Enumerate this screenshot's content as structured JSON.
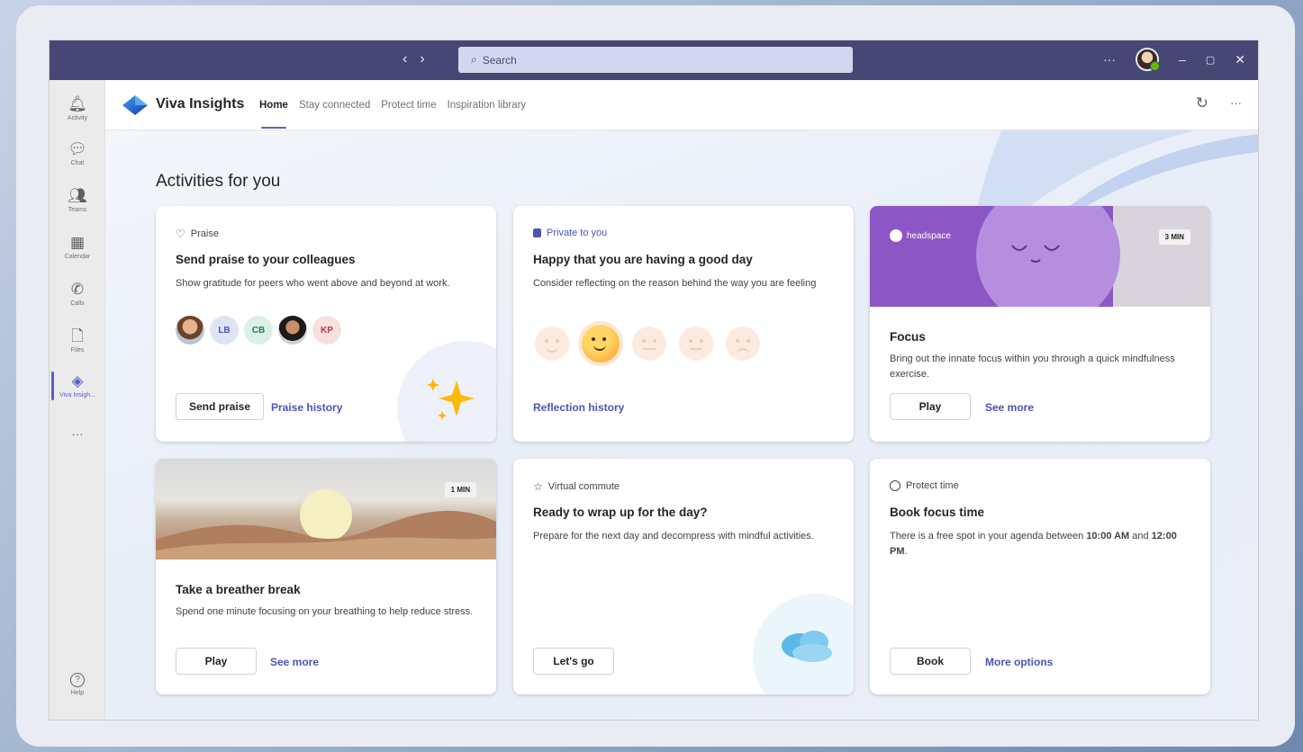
{
  "titlebar": {
    "back_icon": "chevron-left-icon",
    "forward_icon": "chevron-right-icon",
    "search_placeholder": "Search",
    "more_label": "···",
    "minimize_label": "–",
    "maximize_label": "▢",
    "close_label": "✕",
    "bg_color": "#464775"
  },
  "rail": {
    "items": [
      {
        "label": "Activity",
        "icon": "bell-icon",
        "glyph": "🔔︎"
      },
      {
        "label": "Chat",
        "icon": "chat-icon",
        "glyph": "💬︎"
      },
      {
        "label": "Teams",
        "icon": "teams-icon",
        "glyph": "👥︎"
      },
      {
        "label": "Calendar",
        "icon": "calendar-icon",
        "glyph": "▦"
      },
      {
        "label": "Calls",
        "icon": "phone-icon",
        "glyph": "✆"
      },
      {
        "label": "Files",
        "icon": "file-icon",
        "glyph": "🗋"
      },
      {
        "label": "Viva Insigh...",
        "icon": "viva-insights-icon",
        "glyph": "◈"
      }
    ],
    "more_label": "···",
    "help_label": "Help",
    "help_glyph": "?"
  },
  "header": {
    "app_title": "Viva Insights",
    "tabs": [
      "Home",
      "Stay connected",
      "Protect time",
      "Inspiration library"
    ],
    "active_tab": "Home",
    "refresh_glyph": "↻",
    "more_glyph": "···"
  },
  "main": {
    "section_title": "Activities for you",
    "cards": {
      "praise": {
        "eyebrow": "Praise",
        "title": "Send praise to your colleagues",
        "desc": "Show gratitude for peers who went above and beyond at work.",
        "avatars": [
          "LB",
          "CB",
          "KP"
        ],
        "primary": "Send praise",
        "link": "Praise history"
      },
      "reflection": {
        "eyebrow": "Private to you",
        "title": "Happy that you are having a good day",
        "desc": "Consider reflecting on the reason behind the way you are feeling",
        "link": "Reflection history"
      },
      "focus": {
        "brand": "headspace",
        "badge": "3 MIN",
        "title": "Focus",
        "desc": "Bring out the innate focus within you through a quick mindfulness exercise.",
        "primary": "Play",
        "link": "See more"
      },
      "breather": {
        "badge": "1 MIN",
        "title": "Take a breather break",
        "desc": "Spend one minute focusing on your breathing to help reduce stress.",
        "primary": "Play",
        "link": "See more"
      },
      "commute": {
        "eyebrow": "Virtual commute",
        "title": "Ready to wrap up for the day?",
        "desc": "Prepare for the next day and decompress with mindful activities.",
        "primary": "Let's go"
      },
      "protect": {
        "eyebrow": "Protect time",
        "title": "Book focus time",
        "desc_prefix": "There is a free spot in your agenda between ",
        "time_start": "10:00 AM",
        "desc_mid": " and ",
        "time_end": "12:00 PM",
        "desc_suffix": ".",
        "primary": "Book",
        "link": "More options"
      }
    }
  },
  "colors": {
    "accent": "#5b5fc7",
    "link": "#4f52b2",
    "headspace_purple": "#8c56c4"
  }
}
